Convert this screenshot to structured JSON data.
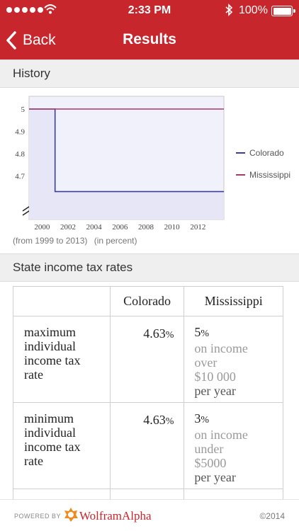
{
  "status_bar": {
    "time": "2:33 PM",
    "battery": "100%"
  },
  "nav": {
    "back_label": "Back",
    "title": "Results"
  },
  "history": {
    "header": "History",
    "note_range": "(from 1999 to 2013)",
    "note_unit": "(in percent)"
  },
  "chart_data": {
    "type": "line",
    "xlim": [
      1999,
      2014
    ],
    "ylim": [
      4.6,
      5.0
    ],
    "x_ticks": [
      "2000",
      "2002",
      "2004",
      "2006",
      "2008",
      "2010",
      "2012"
    ],
    "y_ticks": [
      "5",
      "4.9",
      "4.8",
      "4.7"
    ],
    "axis_break": true,
    "legend_placement": "right",
    "series": [
      {
        "name": "Colorado",
        "color": "#3b3f94",
        "points": [
          [
            1999,
            5.0
          ],
          [
            2001,
            5.0
          ],
          [
            2001,
            4.63
          ],
          [
            2014,
            4.63
          ]
        ]
      },
      {
        "name": "Mississippi",
        "color": "#a33b6b",
        "points": [
          [
            1999,
            5.0
          ],
          [
            2014,
            5.0
          ]
        ]
      }
    ]
  },
  "tax": {
    "header": "State income tax rates",
    "columns": [
      "",
      "Colorado",
      "Mississippi"
    ],
    "rows": [
      {
        "label": "maximum individual income tax rate",
        "colorado": "4.63",
        "colorado_unit": "%",
        "mississippi": "5",
        "mississippi_unit": "%",
        "ms_line1": "on income",
        "ms_line2": "over",
        "ms_line3": "$10 000",
        "ms_line4": "per year"
      },
      {
        "label": "minimum individual income tax rate",
        "colorado": "4.63",
        "colorado_unit": "%",
        "mississippi": "3",
        "mississippi_unit": "%",
        "ms_line1": "on income",
        "ms_line2": "under",
        "ms_line3": "$5000",
        "ms_line4": "per year"
      }
    ]
  },
  "footer": {
    "powered_by": "POWERED BY",
    "brand": "WolframAlpha",
    "copyright": "©2014"
  }
}
